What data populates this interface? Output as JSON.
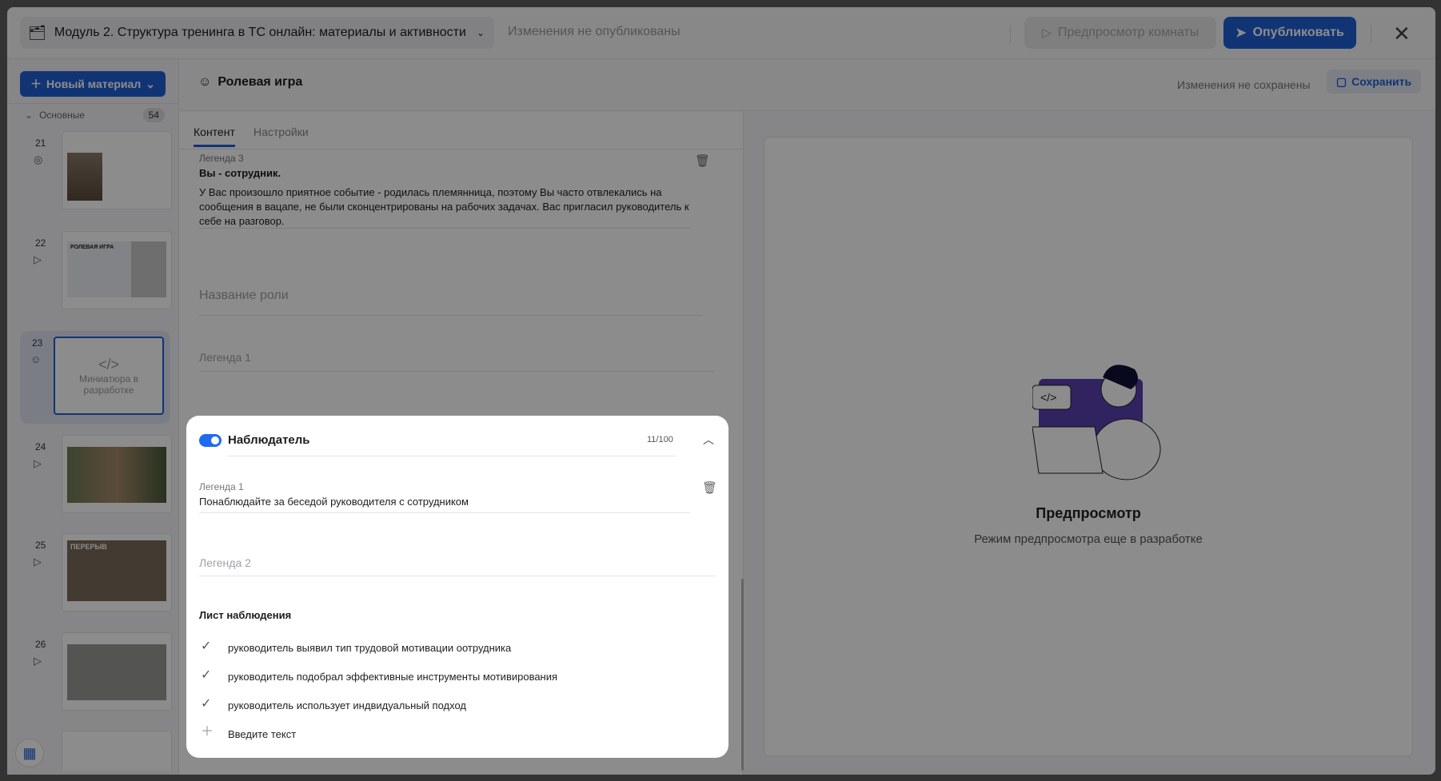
{
  "topbar": {
    "title": "Модуль 2. Структура тренинга в ТС онлайн: материалы и активности",
    "publish_status": "Изменения не опубликованы",
    "preview_room": "Предпросмотр комнаты",
    "publish": "Опубликовать"
  },
  "sidebar": {
    "new_material": "Новый материал",
    "section": "Основные",
    "count": "54",
    "slides": [
      {
        "num": "21"
      },
      {
        "num": "22",
        "thumb_title": "РОЛЕВАЯ ИГРА"
      },
      {
        "num": "23",
        "placeholder": "Миниатюра в разработке"
      },
      {
        "num": "24"
      },
      {
        "num": "25",
        "thumb_title": "ПЕРЕРЫВ"
      },
      {
        "num": "26"
      }
    ]
  },
  "header": {
    "title": "Ролевая игра",
    "save_status": "Изменения не сохранены",
    "save": "Сохранить"
  },
  "tabs": [
    "Контент",
    "Настройки"
  ],
  "role_prev": {
    "legend_label": "Легенда 3",
    "heading": "Вы - сотрудник.",
    "body": "У Вас произошло приятное событие - родилась племянница, поэтому Вы часто отвлекались на сообщения в вацапе, не были сконцентрированы на рабочих задачах. Вас пригласил руководитель к себе на разговор."
  },
  "role_new": {
    "name_placeholder": "Название роли",
    "legend1_placeholder": "Легенда 1"
  },
  "observer": {
    "title": "Наблюдатель",
    "counter": "11/100",
    "legend1_label": "Легенда 1",
    "legend1_value": "Понаблюдайте за  беседой руководителя с сотрудником",
    "legend2_placeholder": "Легенда 2",
    "sheet_title": "Лист наблюдения",
    "items": [
      "руководитель выявил тип трудовой мотивации оотрудника",
      "руководитель подобрал эффективные инструменты мотивирования",
      "руководитель использует индвидуальный подход"
    ],
    "add_placeholder": "Введите текст"
  },
  "preview": {
    "title": "Предпросмотр",
    "subtitle": "Режим предпросмотра еще в разработке"
  }
}
